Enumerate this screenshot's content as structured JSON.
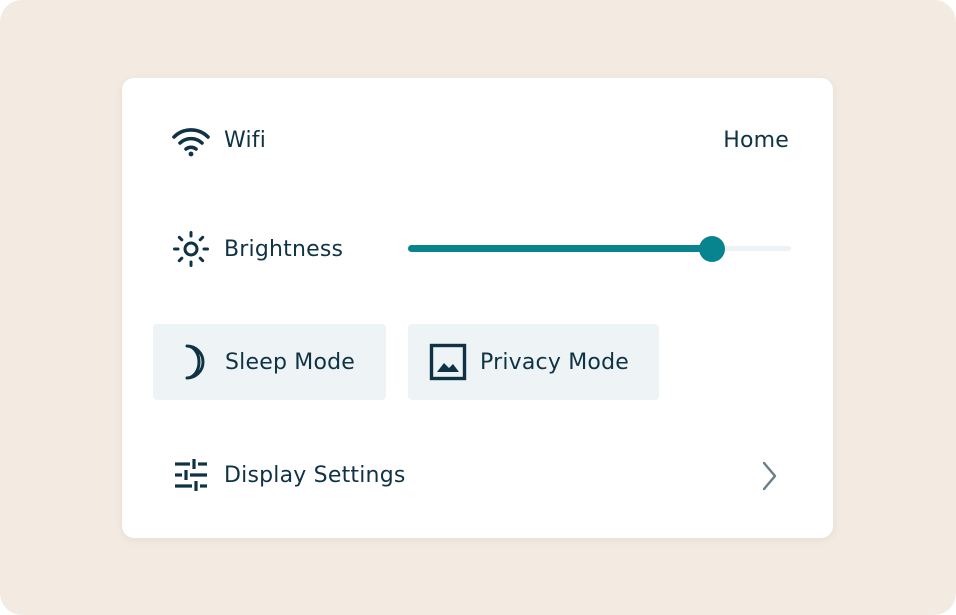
{
  "colors": {
    "page_background": "#f3ebe2",
    "card_background": "#ffffff",
    "text": "#0f3344",
    "accent": "#08848f",
    "button_background": "#eef3f6",
    "chevron": "#6b7d86"
  },
  "wifi": {
    "label": "Wifi",
    "icon": "wifi-icon",
    "value": "Home"
  },
  "brightness": {
    "label": "Brightness",
    "icon": "sun-icon",
    "level": 0.795
  },
  "modes": {
    "sleep": {
      "label": "Sleep Mode",
      "icon": "moon-icon"
    },
    "privacy": {
      "label": "Privacy Mode",
      "icon": "image-icon"
    }
  },
  "display_settings": {
    "label": "Display Settings",
    "icon": "sliders-icon",
    "chevron_icon": "chevron-right-icon"
  }
}
